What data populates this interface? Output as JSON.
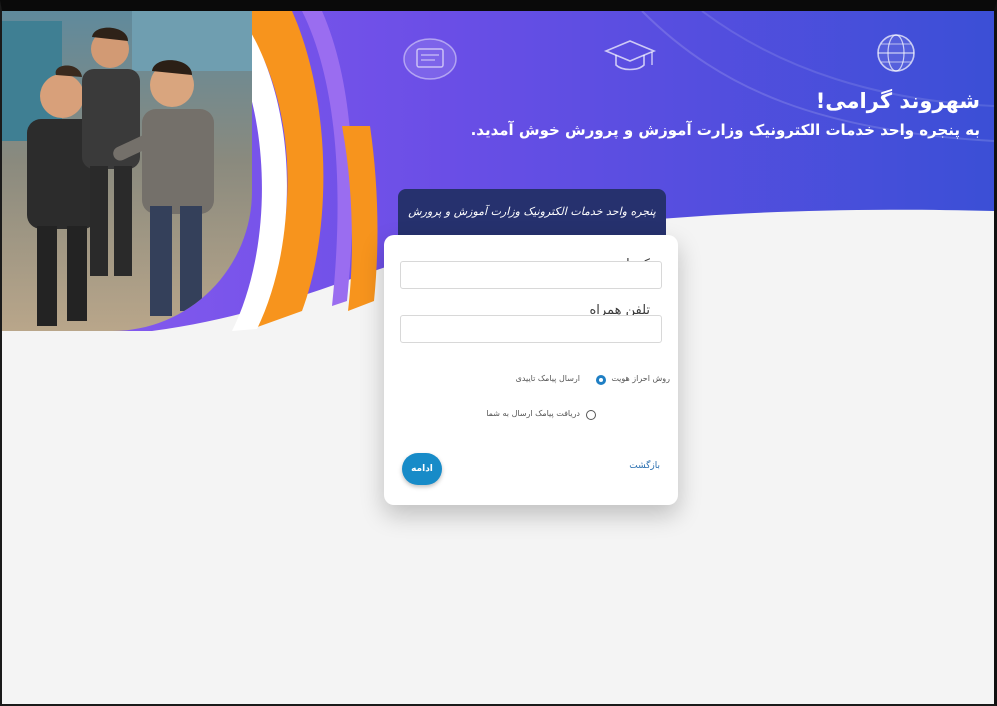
{
  "colors": {
    "banner_start": "#8b5cf0",
    "banner_end": "#3b4fd6",
    "accent_orange": "#f7941d",
    "header_badge": "#26316e",
    "primary_button": "#178bc8"
  },
  "banner": {
    "greeting": "شهروند گرامی!",
    "welcome": "به پنجره واحد خدمات الکترونیک وزارت آموزش و پرورش خوش آمدید.",
    "icons": [
      "certificate-icon",
      "graduation-cap-icon",
      "globe-icon"
    ]
  },
  "card": {
    "header": "پنجره واحد خدمات الکترونیک وزارت آموزش و پرورش",
    "national_code_label": "کدملی",
    "national_code_value": "",
    "phone_label": "تلفن همراه",
    "phone_value": "",
    "auth_method_label": "روش احراز هویت",
    "option_sms": "ارسال پیامک تاییدی",
    "option_receive": "دریافت پیامک ارسال به شما",
    "selected_option": "ارسال پیامک تاییدی",
    "continue_button": "ادامه",
    "back_link": "بازگشت"
  }
}
